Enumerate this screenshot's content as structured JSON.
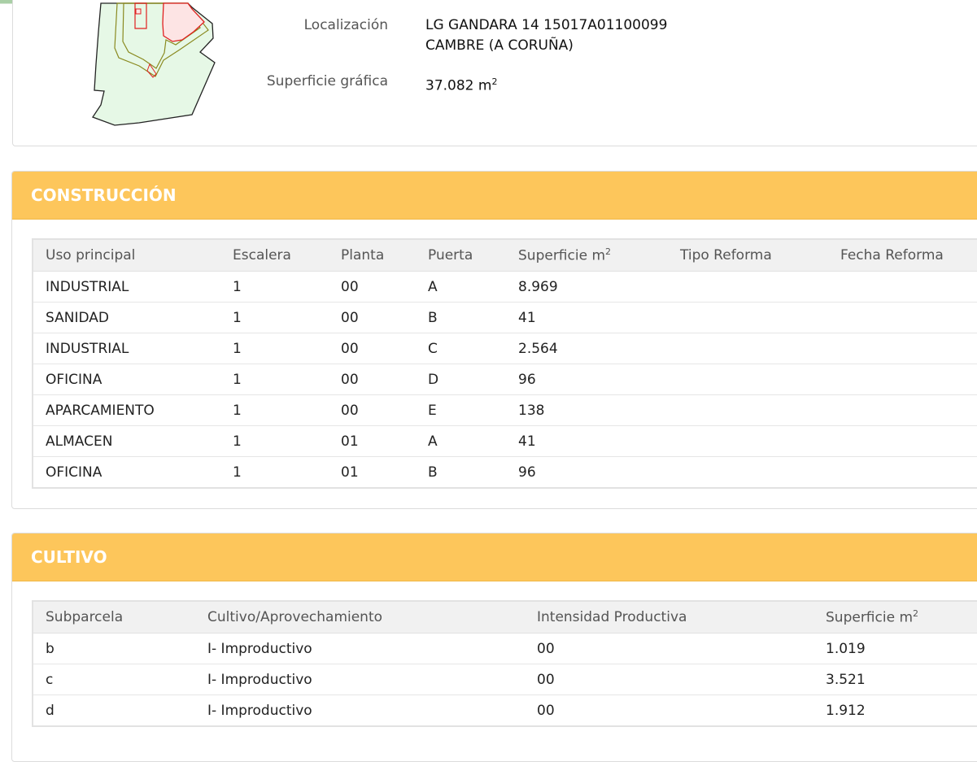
{
  "info": {
    "location_label": "Localización",
    "location_line1": "LG GANDARA 14 15017A01100099",
    "location_line2": "CAMBRE (A CORUÑA)",
    "area_label": "Superficie gráfica",
    "area_value": "37.082 m",
    "area_unit_exp": "2"
  },
  "construccion": {
    "title": "CONSTRUCCIÓN",
    "columns": [
      "Uso principal",
      "Escalera",
      "Planta",
      "Puerta",
      "Superficie m",
      "Tipo Reforma",
      "Fecha Reforma"
    ],
    "area_exp": "2",
    "rows": [
      [
        "INDUSTRIAL",
        "1",
        "00",
        "A",
        "8.969",
        "",
        ""
      ],
      [
        "SANIDAD",
        "1",
        "00",
        "B",
        "41",
        "",
        ""
      ],
      [
        "INDUSTRIAL",
        "1",
        "00",
        "C",
        "2.564",
        "",
        ""
      ],
      [
        "OFICINA",
        "1",
        "00",
        "D",
        "96",
        "",
        ""
      ],
      [
        "APARCAMIENTO",
        "1",
        "00",
        "E",
        "138",
        "",
        ""
      ],
      [
        "ALMACEN",
        "1",
        "01",
        "A",
        "41",
        "",
        ""
      ],
      [
        "OFICINA",
        "1",
        "01",
        "B",
        "96",
        "",
        ""
      ]
    ]
  },
  "cultivo": {
    "title": "CULTIVO",
    "columns": [
      "Subparcela",
      "Cultivo/Aprovechamiento",
      "Intensidad Productiva",
      "Superficie m"
    ],
    "area_exp": "2",
    "rows": [
      [
        "b",
        "I- Improductivo",
        "00",
        "1.019"
      ],
      [
        "c",
        "I- Improductivo",
        "00",
        "3.521"
      ],
      [
        "d",
        "I- Improductivo",
        "00",
        "1.912"
      ]
    ]
  },
  "colors": {
    "header_bg": "#fdc65b",
    "parcel_fill": "#e6f8e6",
    "building_fill": "#fde4e4",
    "building_stroke": "#e02020",
    "subparcel_stroke": "#8a8a20"
  }
}
